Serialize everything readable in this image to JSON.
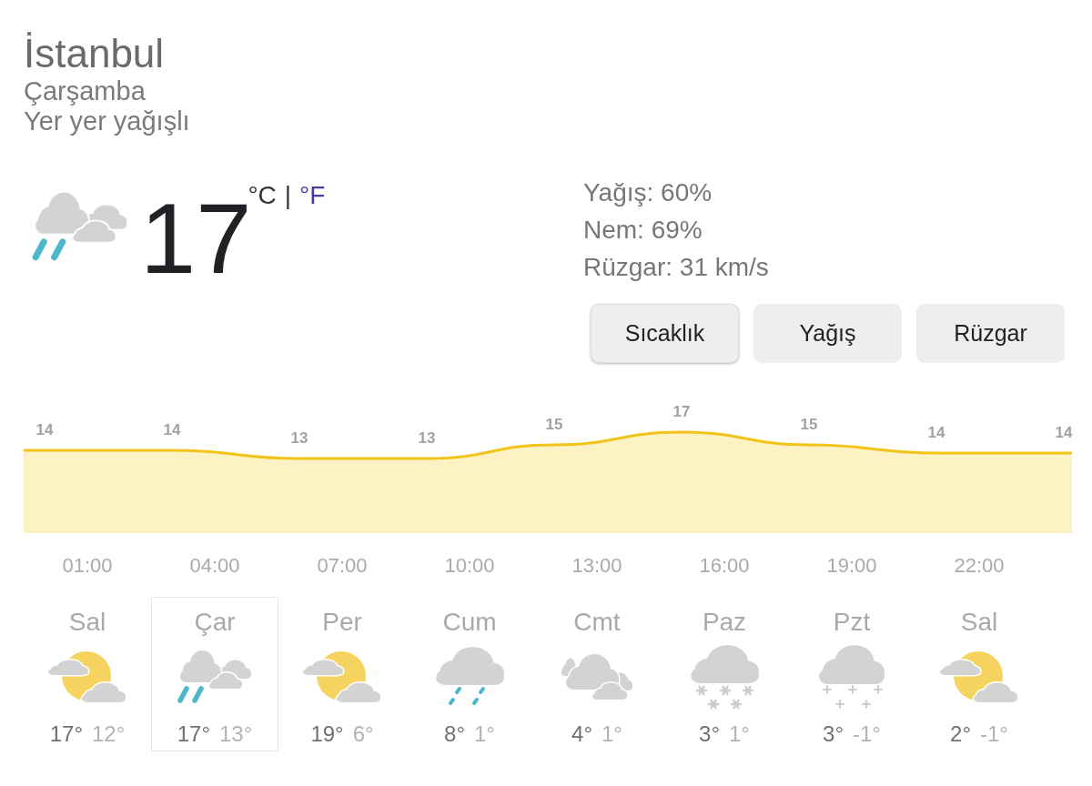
{
  "location": {
    "city": "İstanbul",
    "day": "Çarşamba",
    "condition": "Yer yer yağışlı"
  },
  "current": {
    "kind": "rain-showers",
    "temperature": "17",
    "units": [
      {
        "label": "°C",
        "selected": true
      },
      {
        "label": "°F",
        "selected": false
      }
    ],
    "unit_separator": "|"
  },
  "details": [
    "Yağış: 60%",
    "Nem: 69%",
    "Rüzgar: 31 km/s"
  ],
  "tabs": [
    {
      "label": "Sıcaklık",
      "selected": true
    },
    {
      "label": "Yağış",
      "selected": false
    },
    {
      "label": "Rüzgar",
      "selected": false
    }
  ],
  "hourly": {
    "readings": [
      "14",
      "14",
      "13",
      "13",
      "15",
      "17",
      "15",
      "14",
      "14"
    ],
    "times": [
      "01:00",
      "04:00",
      "07:00",
      "10:00",
      "13:00",
      "16:00",
      "19:00",
      "22:00"
    ]
  },
  "forecast": {
    "days": [
      {
        "name": "Sal",
        "kind": "partly-sunny",
        "high": "17°",
        "low": "12°",
        "selected": false
      },
      {
        "name": "Çar",
        "kind": "rain-showers",
        "high": "17°",
        "low": "13°",
        "selected": true
      },
      {
        "name": "Per",
        "kind": "partly-sunny",
        "high": "19°",
        "low": "6°",
        "selected": false
      },
      {
        "name": "Cum",
        "kind": "rain",
        "high": "8°",
        "low": "1°",
        "selected": false
      },
      {
        "name": "Cmt",
        "kind": "cloudy",
        "high": "4°",
        "low": "1°",
        "selected": false
      },
      {
        "name": "Paz",
        "kind": "snow",
        "high": "3°",
        "low": "1°",
        "selected": false
      },
      {
        "name": "Pzt",
        "kind": "light-snow",
        "high": "3°",
        "low": "-1°",
        "selected": false
      },
      {
        "name": "Sal",
        "kind": "partly-sunny",
        "high": "2°",
        "low": "-1°",
        "selected": false
      }
    ]
  }
}
